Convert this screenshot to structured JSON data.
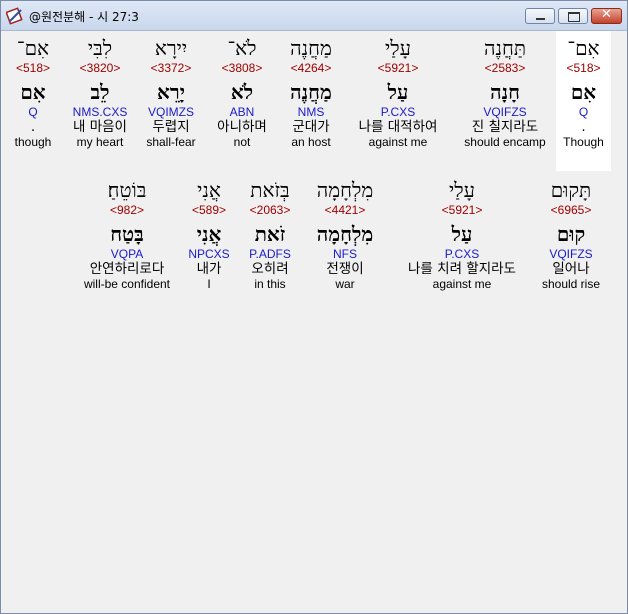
{
  "window": {
    "title": "@원전분해 - 시 27:3",
    "app_icon": "book-pen-icon",
    "controls": {
      "minimize": "minimize-icon",
      "maximize": "maximize-icon",
      "close": "✕"
    }
  },
  "colors": {
    "strong": "#a00000",
    "morph": "#1a1acc",
    "selected_bg": "#ffffff",
    "panel_bg": "#f0f0f0"
  },
  "lines": [
    {
      "words": [
        {
          "hebrew": "אִם־",
          "strong": "<518>",
          "root": "אִם",
          "morph": "Q",
          "korean": ".",
          "english": "though"
        },
        {
          "hebrew": "לִבִּי",
          "strong": "<3820>",
          "root": "לֵב",
          "morph": "NMS.CXS",
          "korean": "내 마음이",
          "english": "my heart"
        },
        {
          "hebrew": "יִירָא",
          "strong": "<3372>",
          "root": "יָרֵא",
          "morph": "VQIMZS",
          "korean": "두렵지",
          "english": "shall-fear"
        },
        {
          "hebrew": "לֹא־",
          "strong": "<3808>",
          "root": "לֹא",
          "morph": "ABN",
          "korean": "아니하며",
          "english": "not"
        },
        {
          "hebrew": "מַחֲנֶה",
          "strong": "<4264>",
          "root": "מַחֲנֶה",
          "morph": "NMS",
          "korean": "군대가",
          "english": "an host"
        },
        {
          "hebrew": "עָלַי",
          "strong": "<5921>",
          "root": "עַל",
          "morph": "P.CXS",
          "korean": "나를 대적하여",
          "english": "against me"
        },
        {
          "hebrew": "תַּחֲנֶה",
          "strong": "<2583>",
          "root": "חָנָה",
          "morph": "VQIFZS",
          "korean": "진 칠지라도",
          "english": "should encamp"
        },
        {
          "hebrew": "אִם־",
          "strong": "<518>",
          "root": "אִם",
          "morph": "Q",
          "korean": ".",
          "english": "Though"
        }
      ]
    },
    {
      "words": [
        {
          "hebrew": "בּוֹטֵחַ׃",
          "strong": "<982>",
          "root": "בָּטַח",
          "morph": "VQPA",
          "korean": "안연하리로다",
          "english": "will-be confident"
        },
        {
          "hebrew": "אֲנִי",
          "strong": "<589>",
          "root": "אֲנִי",
          "morph": "NPCXS",
          "korean": "내가",
          "english": "I"
        },
        {
          "hebrew": "בְּזֹאת",
          "strong": "<2063>",
          "root": "זֹאת",
          "morph": "P.ADFS",
          "korean": "오히려",
          "english": "in this"
        },
        {
          "hebrew": "מִלְחָמָה",
          "strong": "<4421>",
          "root": "מִלְחָמָה",
          "morph": "NFS",
          "korean": "전쟁이",
          "english": "war"
        },
        {
          "hebrew": "עָלַי",
          "strong": "<5921>",
          "root": "עַל",
          "morph": "P.CXS",
          "korean": "나를 치려 할지라도",
          "english": "against me"
        },
        {
          "hebrew": "תָּקוּם",
          "strong": "<6965>",
          "root": "קוּם",
          "morph": "VQIFZS",
          "korean": "일어나",
          "english": "should rise"
        }
      ]
    }
  ]
}
